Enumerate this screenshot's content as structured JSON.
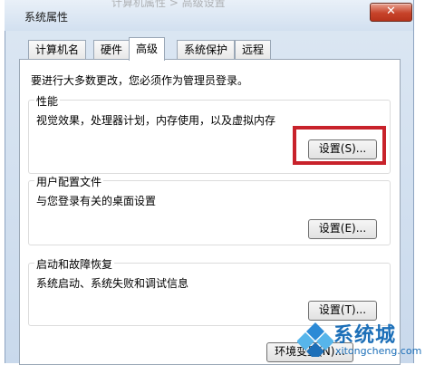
{
  "window": {
    "title": "系统属性",
    "ghost_text": "计算机属性 > 高级设置",
    "close_symbol": "✕"
  },
  "tabs": [
    {
      "label": "计算机名"
    },
    {
      "label": "硬件"
    },
    {
      "label": "高级"
    },
    {
      "label": "系统保护"
    },
    {
      "label": "远程"
    }
  ],
  "active_tab": "高级",
  "panel": {
    "intro": "要进行大多数更改，您必须作为管理员登录。",
    "performance": {
      "title": "性能",
      "desc": "视觉效果，处理器计划，内存使用，以及虚拟内存",
      "button": "设置(S)..."
    },
    "user_profiles": {
      "title": "用户配置文件",
      "desc": "与您登录有关的桌面设置",
      "button": "设置(E)..."
    },
    "startup_recovery": {
      "title": "启动和故障恢复",
      "desc": "系统启动、系统失败和调试信息",
      "button": "设置(T)..."
    },
    "env_button": "环境变量(N)..."
  },
  "watermark": {
    "brand": "系统城",
    "url": "xitongcheng.com"
  },
  "colors": {
    "highlight": "#c8222b",
    "close_button": "#c7432a",
    "watermark": "#1c6fb8"
  }
}
